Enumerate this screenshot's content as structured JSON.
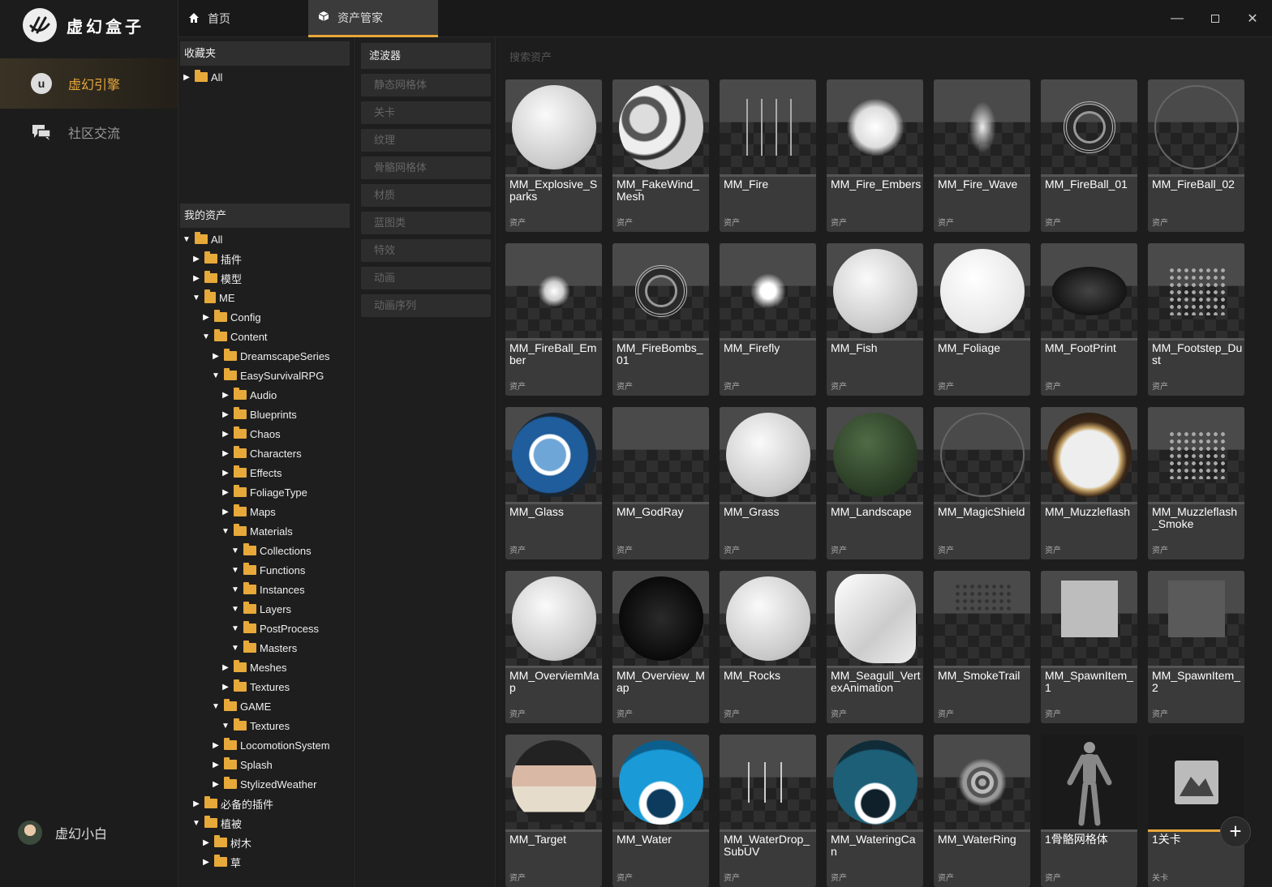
{
  "app": {
    "title": "虚幻盒子"
  },
  "nav": {
    "items": [
      {
        "label": "虚幻引擎",
        "icon": "unreal-logo-icon",
        "active": true
      },
      {
        "label": "社区交流",
        "icon": "chat-icon",
        "active": false
      }
    ],
    "user": {
      "name": "虚幻小白"
    }
  },
  "tabs": [
    {
      "label": "首页",
      "icon": "home-icon"
    },
    {
      "label": "资产管家",
      "icon": "cube-icon"
    }
  ],
  "favorites": {
    "title": "收藏夹",
    "items": [
      {
        "label": "All"
      }
    ]
  },
  "myassets": {
    "title": "我的资产",
    "tree": [
      {
        "label": "All",
        "depth": 0,
        "open": true
      },
      {
        "label": "插件",
        "depth": 1,
        "open": false
      },
      {
        "label": "模型",
        "depth": 1,
        "open": false
      },
      {
        "label": "ME",
        "depth": 1,
        "open": true,
        "special": true
      },
      {
        "label": "Config",
        "depth": 2,
        "open": false
      },
      {
        "label": "Content",
        "depth": 2,
        "open": true
      },
      {
        "label": "DreamscapeSeries",
        "depth": 3,
        "open": false
      },
      {
        "label": "EasySurvivalRPG",
        "depth": 3,
        "open": true
      },
      {
        "label": "Audio",
        "depth": 4,
        "open": false
      },
      {
        "label": "Blueprints",
        "depth": 4,
        "open": false
      },
      {
        "label": "Chaos",
        "depth": 4,
        "open": false
      },
      {
        "label": "Characters",
        "depth": 4,
        "open": false
      },
      {
        "label": "Effects",
        "depth": 4,
        "open": false
      },
      {
        "label": "FoliageType",
        "depth": 4,
        "open": false
      },
      {
        "label": "Maps",
        "depth": 4,
        "open": false
      },
      {
        "label": "Materials",
        "depth": 4,
        "open": true
      },
      {
        "label": "Collections",
        "depth": 5,
        "open": true
      },
      {
        "label": "Functions",
        "depth": 5,
        "open": true
      },
      {
        "label": "Instances",
        "depth": 5,
        "open": true
      },
      {
        "label": "Layers",
        "depth": 5,
        "open": true
      },
      {
        "label": "PostProcess",
        "depth": 5,
        "open": true
      },
      {
        "label": "Masters",
        "depth": 5,
        "open": true
      },
      {
        "label": "Meshes",
        "depth": 4,
        "open": false
      },
      {
        "label": "Textures",
        "depth": 4,
        "open": false
      },
      {
        "label": "GAME",
        "depth": 3,
        "open": true
      },
      {
        "label": "Textures",
        "depth": 4,
        "open": true
      },
      {
        "label": "LocomotionSystem",
        "depth": 3,
        "open": false
      },
      {
        "label": "Splash",
        "depth": 3,
        "open": false
      },
      {
        "label": "StylizedWeather",
        "depth": 3,
        "open": false
      },
      {
        "label": "必备的插件",
        "depth": 1,
        "open": false
      },
      {
        "label": "植被",
        "depth": 1,
        "open": true
      },
      {
        "label": "树木",
        "depth": 2,
        "open": false
      },
      {
        "label": "草",
        "depth": 2,
        "open": false
      }
    ]
  },
  "filters": {
    "title": "滤波器",
    "items": [
      "静态网格体",
      "关卡",
      "纹理",
      "骨骼网格体",
      "材质",
      "蓝图类",
      "特效",
      "动画",
      "动画序列"
    ]
  },
  "search": {
    "placeholder": "搜索资产"
  },
  "assets": [
    {
      "name": "MM_Explosive_Sparks",
      "type": "资产",
      "thumb": "sphere-white"
    },
    {
      "name": "MM_FakeWind_Mesh",
      "type": "资产",
      "thumb": "sphere-moon"
    },
    {
      "name": "MM_Fire",
      "type": "资产",
      "thumb": "fire"
    },
    {
      "name": "MM_Fire_Embers",
      "type": "资产",
      "thumb": "blob-white"
    },
    {
      "name": "MM_Fire_Wave",
      "type": "资产",
      "thumb": "wisp"
    },
    {
      "name": "MM_FireBall_01",
      "type": "资产",
      "thumb": "ring-pattern"
    },
    {
      "name": "MM_FireBall_02",
      "type": "资产",
      "thumb": "ring-dark"
    },
    {
      "name": "MM_FireBall_Ember",
      "type": "资产",
      "thumb": "glow-small"
    },
    {
      "name": "MM_FireBombs_01",
      "type": "资产",
      "thumb": "ring-pattern"
    },
    {
      "name": "MM_Firefly",
      "type": "资产",
      "thumb": "glow-bright"
    },
    {
      "name": "MM_Fish",
      "type": "资产",
      "thumb": "sphere-white"
    },
    {
      "name": "MM_Foliage",
      "type": "资产",
      "thumb": "sphere-bright"
    },
    {
      "name": "MM_FootPrint",
      "type": "资产",
      "thumb": "sphere-dark"
    },
    {
      "name": "MM_Footstep_Dust",
      "type": "资产",
      "thumb": "grid-dots"
    },
    {
      "name": "MM_Glass",
      "type": "资产",
      "thumb": "sphere-earth"
    },
    {
      "name": "MM_GodRay",
      "type": "资产",
      "thumb": "empty"
    },
    {
      "name": "MM_Grass",
      "type": "资产",
      "thumb": "sphere-white"
    },
    {
      "name": "MM_Landscape",
      "type": "资产",
      "thumb": "sphere-camo"
    },
    {
      "name": "MM_MagicShield",
      "type": "资产",
      "thumb": "ring-dark"
    },
    {
      "name": "MM_Muzzleflash",
      "type": "资产",
      "thumb": "sphere-burn"
    },
    {
      "name": "MM_Muzzleflash_Smoke",
      "type": "资产",
      "thumb": "grid-dots"
    },
    {
      "name": "MM_OverviemMap",
      "type": "资产",
      "thumb": "sphere-white"
    },
    {
      "name": "MM_Overview_Map",
      "type": "资产",
      "thumb": "sphere-black"
    },
    {
      "name": "MM_Rocks",
      "type": "资产",
      "thumb": "sphere-white"
    },
    {
      "name": "MM_Seagull_VertexAnimation",
      "type": "资产",
      "thumb": "paper"
    },
    {
      "name": "MM_SmokeTrail",
      "type": "资产",
      "thumb": "grid-dots-dark"
    },
    {
      "name": "MM_SpawnItem_1",
      "type": "资产",
      "thumb": "square"
    },
    {
      "name": "MM_SpawnItem_2",
      "type": "资产",
      "thumb": "square-dark"
    },
    {
      "name": "MM_Target",
      "type": "资产",
      "thumb": "sphere-torn"
    },
    {
      "name": "MM_Water",
      "type": "资产",
      "thumb": "sphere-water"
    },
    {
      "name": "MM_WaterDrop_SubUV",
      "type": "资产",
      "thumb": "drops"
    },
    {
      "name": "MM_WateringCan",
      "type": "资产",
      "thumb": "sphere-teal"
    },
    {
      "name": "MM_WaterRing",
      "type": "资产",
      "thumb": "ripple"
    },
    {
      "name": "1骨骼网格体",
      "type": "资产",
      "thumb": "mannequin"
    },
    {
      "name": "1关卡",
      "type": "关卡",
      "thumb": "level-icon",
      "selected": true
    }
  ],
  "colors": {
    "accent": "#e8a73a",
    "bg": "#1d1d1d",
    "card": "#3a3a3a"
  }
}
